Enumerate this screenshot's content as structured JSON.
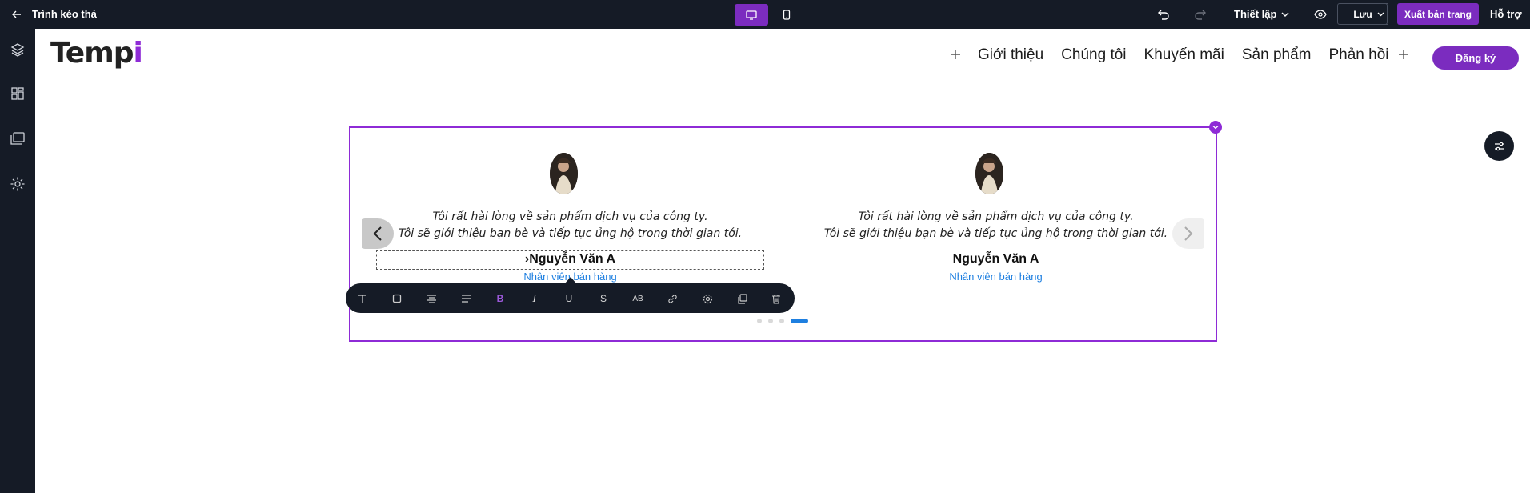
{
  "topbar": {
    "app_title": "Trình kéo thả",
    "setup_label": "Thiết lập",
    "save_label": "Lưu",
    "publish_label": "Xuất bản trang",
    "help_label": "Hỗ trợ"
  },
  "site": {
    "logo_main": "Temp",
    "logo_accent": "i",
    "logo_accent_color": "#8e2bd6",
    "nav": [
      "Giới thiệu",
      "Chúng tôi",
      "Khuyến mãi",
      "Sản phẩm",
      "Phản hồi"
    ],
    "signup_label": "Đăng ký"
  },
  "testimonials": [
    {
      "quote_line1": "Tôi rất hài lòng về sản phẩm dịch vụ của công ty.",
      "quote_line2": "Tôi sẽ giới thiệu bạn bè và tiếp tục ủng hộ trong thời gian tới.",
      "name": "›Nguyễn Văn A",
      "role": "Nhân viên bán hàng"
    },
    {
      "quote_line1": "Tôi rất hài lòng về sản phẩm dịch vụ của công ty.",
      "quote_line2": "Tôi sẽ giới thiệu bạn bè và tiếp tục ủng hộ trong thời gian tới.",
      "name": "Nguyễn Văn A",
      "role": "Nhân viên bán hàng"
    }
  ],
  "carousel": {
    "total_dots": 4,
    "active_dot": 4
  },
  "text_toolbar": {
    "text_icon_label": "T",
    "bold_label": "B",
    "italic_label": "I",
    "underline_label": "U",
    "strike_label": "S",
    "case_label": "AB"
  },
  "colors": {
    "accent": "#7b2cbf",
    "link": "#1e7fe0",
    "dark": "#151b26"
  }
}
